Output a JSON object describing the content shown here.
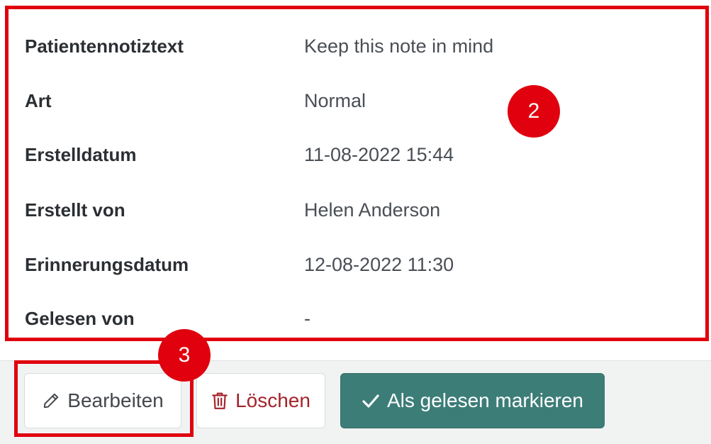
{
  "note_details": {
    "rows": [
      {
        "label": "Patientennotiztext",
        "value": "Keep this note in mind"
      },
      {
        "label": "Art",
        "value": "Normal"
      },
      {
        "label": "Erstelldatum",
        "value": "11-08-2022 15:44"
      },
      {
        "label": "Erstellt von",
        "value": "Helen Anderson"
      },
      {
        "label": "Erinnerungsdatum",
        "value": "12-08-2022 11:30"
      },
      {
        "label": "Gelesen von",
        "value": "-"
      }
    ]
  },
  "actions": {
    "edit_label": "Bearbeiten",
    "edit_icon": "pencil-icon",
    "delete_label": "Löschen",
    "delete_icon": "trash-icon",
    "mark_read_label": "Als gelesen markieren",
    "mark_read_icon": "check-icon"
  },
  "annotations": {
    "callout_details": "2",
    "callout_edit": "3"
  },
  "colors": {
    "annotation_red": "#e0000e",
    "primary_teal": "#3d7d78",
    "danger_text": "#a4232a"
  }
}
